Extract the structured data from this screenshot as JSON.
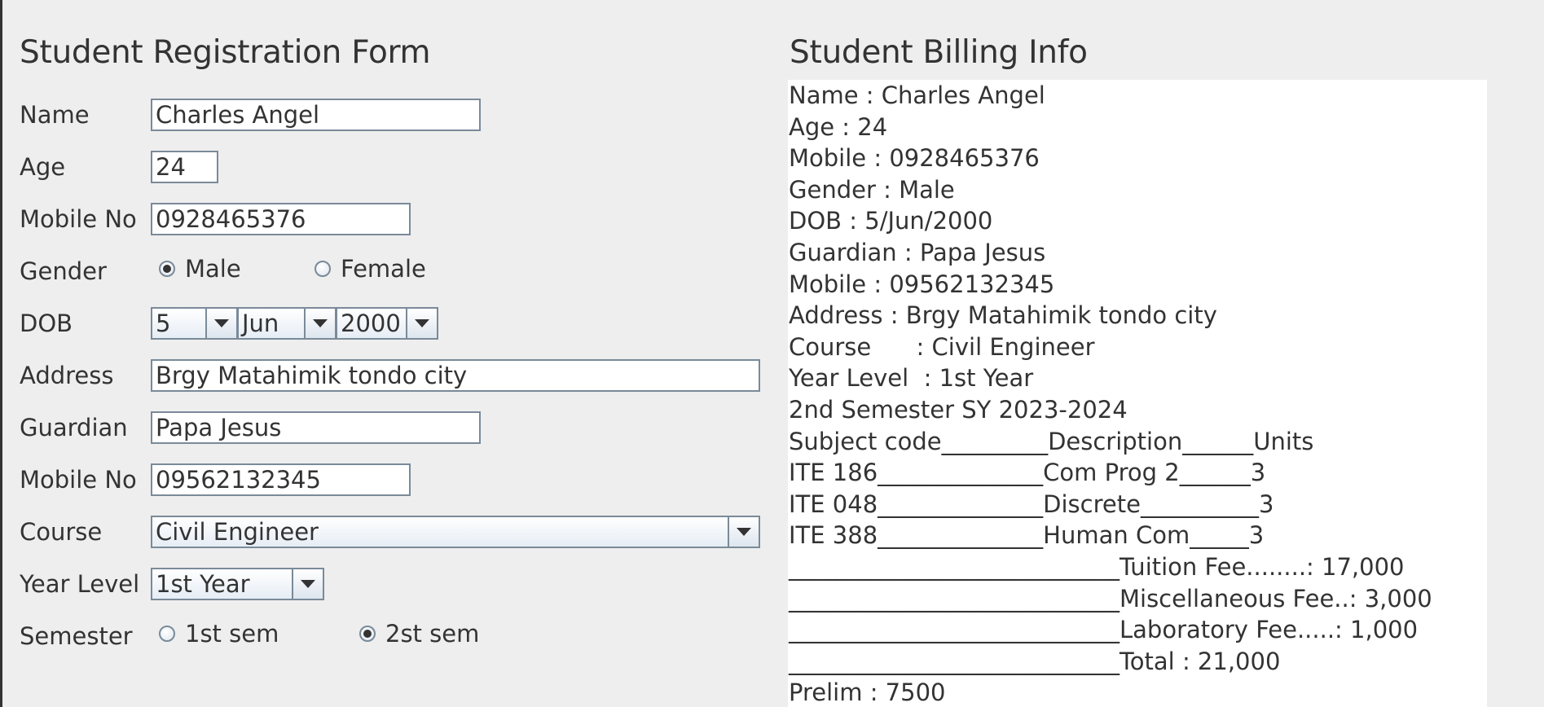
{
  "form": {
    "title": "Student Registration Form",
    "labels": {
      "name": "Name",
      "age": "Age",
      "mobile": "Mobile No",
      "gender": "Gender",
      "dob": "DOB",
      "address": "Address",
      "guardian": "Guardian",
      "guardian_mobile": "Mobile No",
      "course": "Course",
      "year_level": "Year Level",
      "semester": "Semester"
    },
    "values": {
      "name": "Charles Angel",
      "age": "24",
      "mobile": "0928465376",
      "address": "Brgy Matahimik tondo city",
      "guardian": "Papa Jesus",
      "guardian_mobile": "09562132345"
    },
    "gender": {
      "male_label": "Male",
      "female_label": "Female",
      "selected": "Male"
    },
    "dob": {
      "day": "5",
      "month": "Jun",
      "year": "2000"
    },
    "course_selected": "Civil Engineer",
    "year_level_selected": "1st Year",
    "semester": {
      "first_label": "1st sem",
      "second_label": "2st sem",
      "selected": "2st sem"
    }
  },
  "billing": {
    "title": "Student Billing Info",
    "lines": [
      "Name : Charles Angel",
      "Age : 24",
      "Mobile : 0928465376",
      "Gender : Male",
      "DOB : 5/Jun/2000",
      "Guardian : Papa Jesus",
      "Mobile : 09562132345",
      "Address : Brgy Matahimik tondo city",
      "Course      : Civil Engineer",
      "Year Level  : 1st Year",
      "2nd Semester SY 2023-2024",
      "Subject code_________Description______Units",
      "ITE 186______________Com Prog 2______3",
      "ITE 048______________Discrete__________3",
      "ITE 388______________Human Com_____3",
      "____________________________Tuition Fee........: 17,000",
      "____________________________Miscellaneous Fee..: 3,000",
      "____________________________Laboratory Fee.....: 1,000",
      "____________________________Total : 21,000",
      "Prelim : 7500"
    ]
  }
}
